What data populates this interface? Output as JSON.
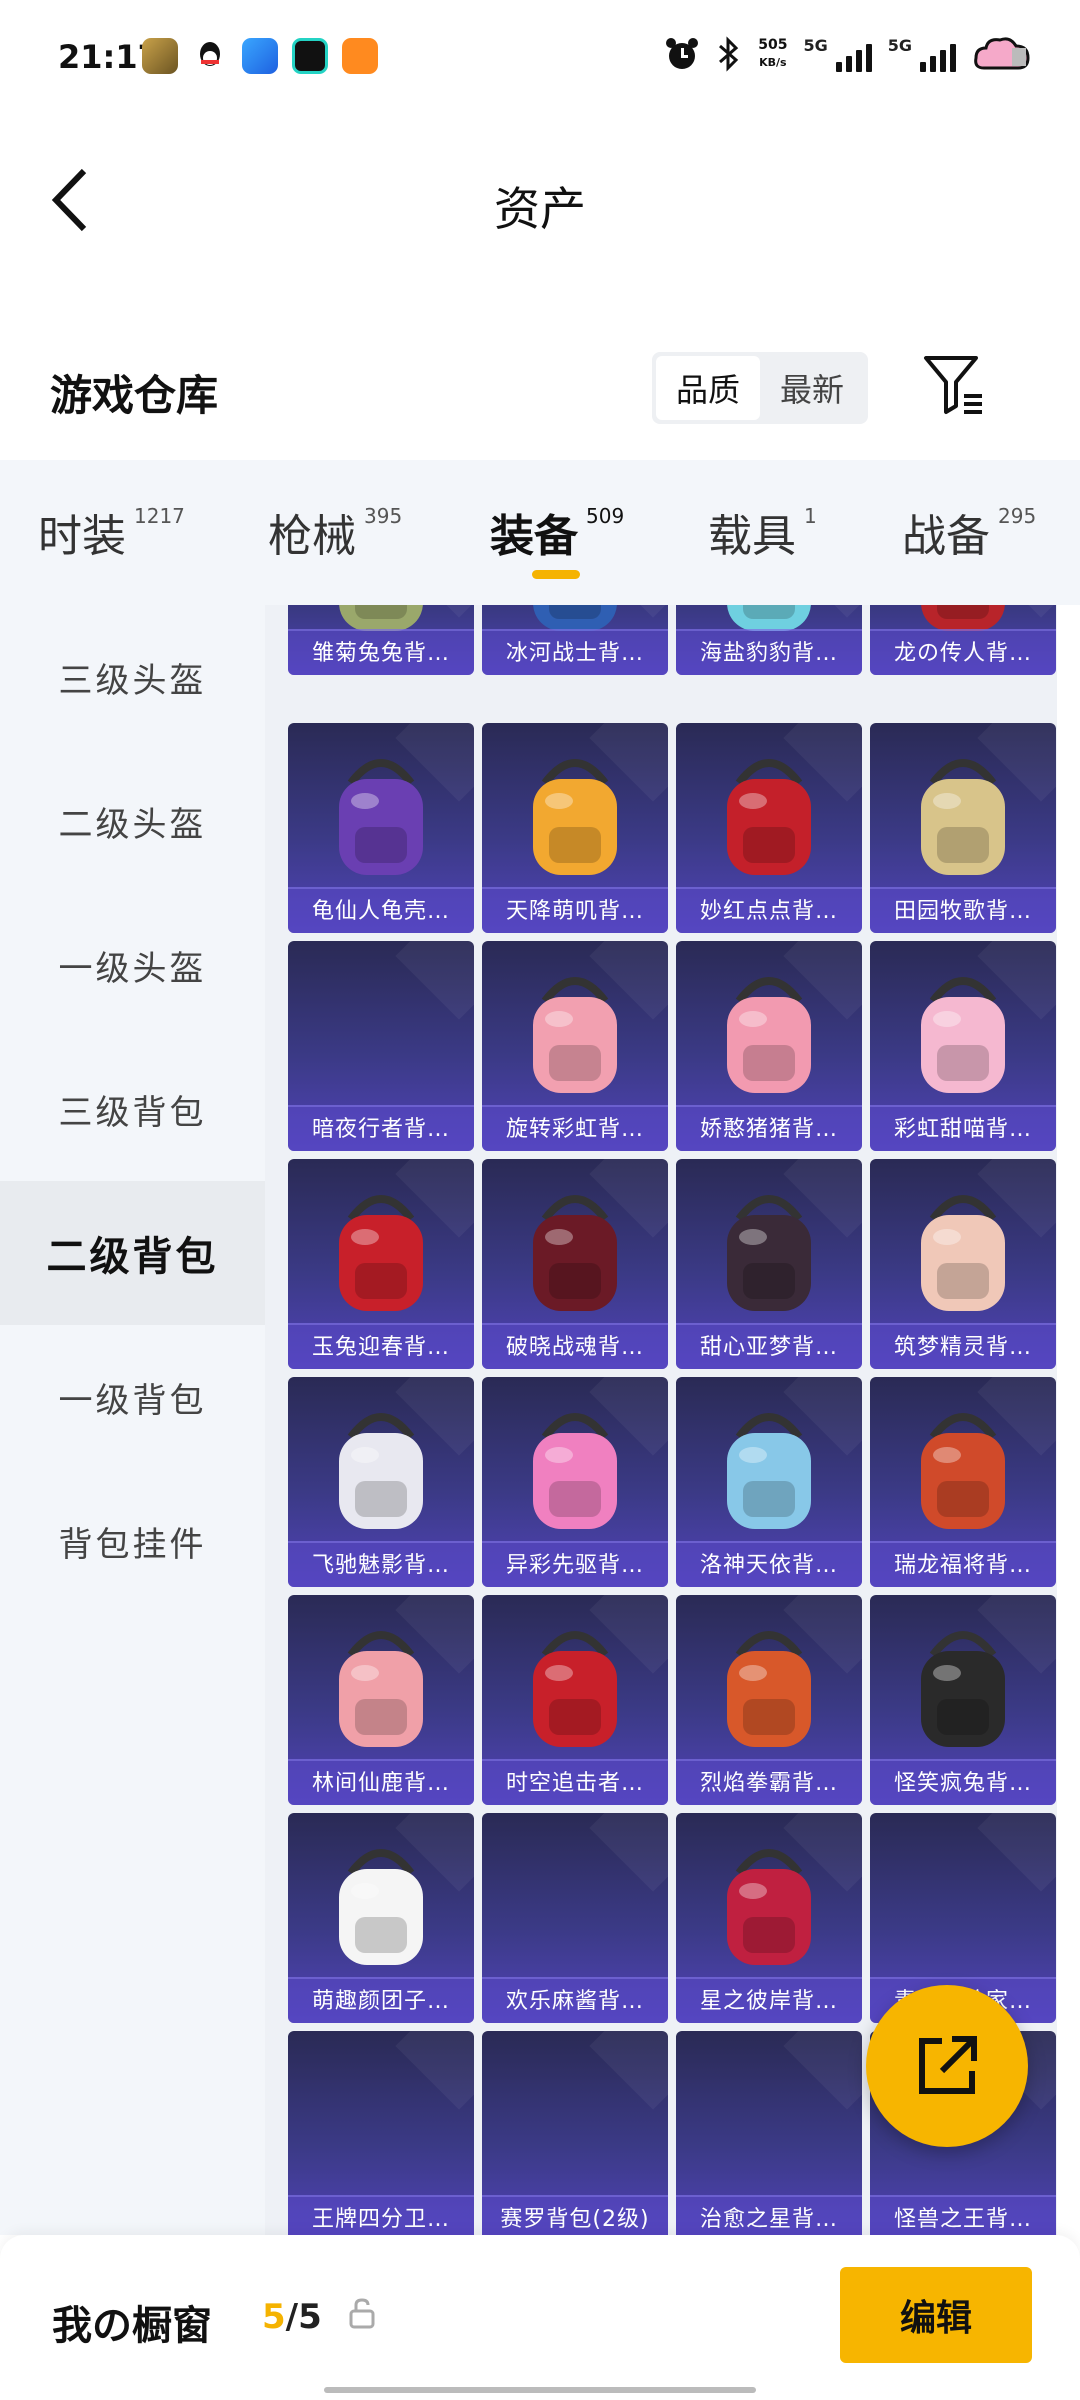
{
  "status_bar": {
    "time": "21:17",
    "net_speed_value": "505",
    "net_speed_unit": "KB/s",
    "signal1": "5G",
    "signal2": "5G",
    "app_icons": [
      "pubg-app-icon",
      "qq-icon",
      "app-blue-icon",
      "app-dark-icon",
      "app-orange-icon"
    ]
  },
  "header": {
    "title": "资产"
  },
  "warehouse": {
    "title": "游戏仓库",
    "sort_options": [
      "品质",
      "最新"
    ],
    "selected_sort": "品质"
  },
  "categories": [
    {
      "label": "时装",
      "count": "1217"
    },
    {
      "label": "枪械",
      "count": "395"
    },
    {
      "label": "装备",
      "count": "509",
      "active": true
    },
    {
      "label": "载具",
      "count": "1"
    },
    {
      "label": "战备",
      "count": "295"
    }
  ],
  "sidebar": {
    "items": [
      "三级头盔",
      "二级头盔",
      "一级头盔",
      "三级背包",
      "二级背包",
      "一级背包",
      "背包挂件"
    ],
    "active_index": 4
  },
  "items": [
    "雏菊兔兔背…",
    "冰河战士背…",
    "海盐豹豹背…",
    "龙の传人背…",
    "龟仙人龟壳…",
    "天降萌叽背…",
    "妙红点点背…",
    "田园牧歌背…",
    "暗夜行者背…",
    "旋转彩虹背…",
    "娇憨猪猪背…",
    "彩虹甜喵背…",
    "玉兔迎春背…",
    "破晓战魂背…",
    "甜心亚梦背…",
    "筑梦精灵背…",
    "飞驰魅影背…",
    "异彩先驱背…",
    "洛神天依背…",
    "瑞龙福将背…",
    "林间仙鹿背…",
    "时空追击者…",
    "烈焰拳霸背…",
    "怪笑疯兔背…",
    "萌趣颜团子…",
    "欢乐麻酱背…",
    "星之彼岸背…",
    "青春冒险家…",
    "王牌四分卫…",
    "赛罗背包(2级)",
    "治愈之星背…",
    "怪兽之王背…"
  ],
  "item_colors": [
    "#9aa86b",
    "#2f5fb3",
    "#6fd0e0",
    "#b8242a",
    "#6a3fb2",
    "#f2a830",
    "#c4202a",
    "#d8c48a",
    "",
    "#f2a0b0",
    "#f29ab0",
    "#f5b8d0",
    "#c8202a",
    "#6b1a26",
    "#3a2a38",
    "#f0c8b8",
    "#e8e8f0",
    "#f080c0",
    "#88c8e8",
    "#d04a2a",
    "#f0a0a8",
    "#c8202a",
    "#d8582a",
    "#2a2a2a",
    "#f5f5f5",
    "",
    "#c02040",
    "",
    "",
    "",
    "",
    ""
  ],
  "bottom": {
    "window_label": "我の橱窗",
    "current": "5",
    "total": "/5",
    "edit_label": "编辑"
  },
  "accent_color": "#f5b301"
}
